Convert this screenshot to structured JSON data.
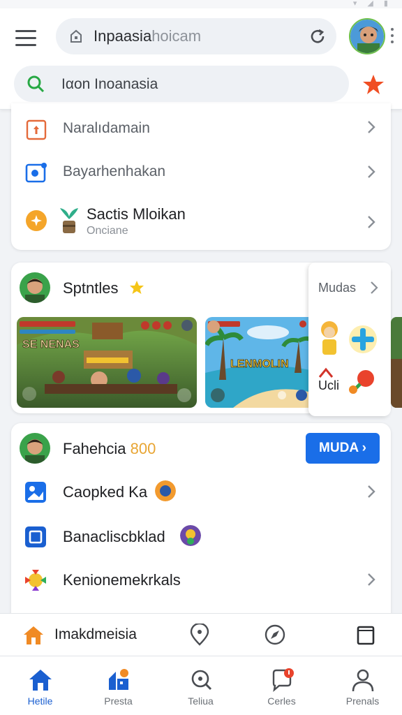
{
  "header": {
    "url_main": "Inpaasia",
    "url_suffix": "hoicam",
    "search_text": "Iαon Inoanasia"
  },
  "list_card": {
    "items": [
      {
        "label": "Naralıdamain",
        "icon": "upload-box-icon"
      },
      {
        "label": "Bayarhenhakan",
        "icon": "camera-box-icon"
      },
      {
        "label": "Sactis Mloikan",
        "sublabel": "Oncianе",
        "icon": "plant-icon"
      }
    ]
  },
  "games_card": {
    "title": "Sptntles",
    "games": [
      {
        "banner": "SE NENAS"
      },
      {
        "banner": "LENMOLIN"
      }
    ],
    "more_label": "Mudas",
    "side_label": "Ucli"
  },
  "profile_card": {
    "title": "Fahehcia",
    "points": "800",
    "action_label": "MUDA",
    "rows": [
      {
        "label": "Caopked Ka",
        "icon": "image-app-icon"
      },
      {
        "label": "Banacliscbklad",
        "icon": "square-app-icon"
      },
      {
        "label": "Kenionemekrkals",
        "icon": "colorful-app-icon"
      }
    ]
  },
  "subnav": {
    "label": "Imakdmeisia"
  },
  "tabs": [
    {
      "label": "Hetile",
      "icon": "home-icon",
      "active": true
    },
    {
      "label": "Presta",
      "icon": "apps-icon",
      "active": false
    },
    {
      "label": "Teliua",
      "icon": "search-icon",
      "active": false
    },
    {
      "label": "Cerles",
      "icon": "chat-icon",
      "active": false
    },
    {
      "label": "Prenals",
      "icon": "profile-icon",
      "active": false
    }
  ],
  "colors": {
    "accent": "#1a6ee8",
    "home_orange": "#f08a24",
    "star": "#f04e23"
  }
}
